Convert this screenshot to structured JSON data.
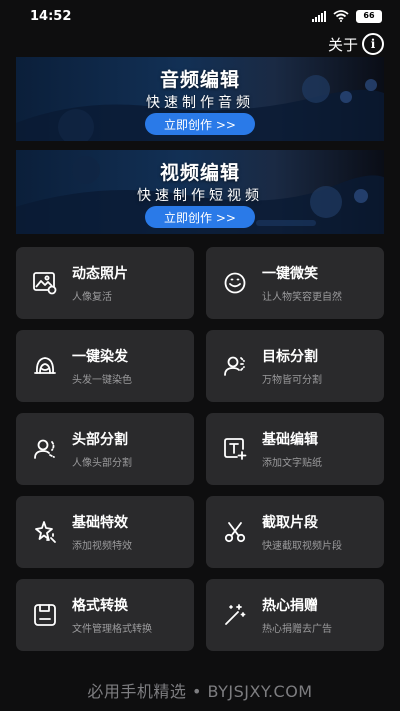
{
  "status_bar": {
    "time": "14:52",
    "battery": "66"
  },
  "header": {
    "about_label": "关于",
    "info_icon": "info-circle-icon"
  },
  "banners": [
    {
      "title": "音频编辑",
      "subtitle": "快速制作音频",
      "button": "立即创作 >>"
    },
    {
      "title": "视频编辑",
      "subtitle": "快速制作短视频",
      "button": "立即创作 >>"
    }
  ],
  "cards": [
    {
      "title": "动态照片",
      "subtitle": "人像复活",
      "icon": "photo-icon"
    },
    {
      "title": "一键微笑",
      "subtitle": "让人物笑容更自然",
      "icon": "smile-icon"
    },
    {
      "title": "一键染发",
      "subtitle": "头发一键染色",
      "icon": "hair-icon"
    },
    {
      "title": "目标分割",
      "subtitle": "万物皆可分割",
      "icon": "segment-icon"
    },
    {
      "title": "头部分割",
      "subtitle": "人像头部分割",
      "icon": "head-segment-icon"
    },
    {
      "title": "基础编辑",
      "subtitle": "添加文字贴纸",
      "icon": "text-add-icon"
    },
    {
      "title": "基础特效",
      "subtitle": "添加视频特效",
      "icon": "sparkle-icon"
    },
    {
      "title": "截取片段",
      "subtitle": "快速截取视频片段",
      "icon": "scissors-icon"
    },
    {
      "title": "格式转换",
      "subtitle": "文件管理格式转换",
      "icon": "save-icon"
    },
    {
      "title": "热心捐赠",
      "subtitle": "热心捐赠去广告",
      "icon": "magic-wand-icon"
    }
  ],
  "footer": {
    "watermark": "必用手机精选 • BYJSJXY.COM"
  },
  "colors": {
    "background": "#0e0e0f",
    "card": "#2a2a2c",
    "accent": "#2a7ae8"
  }
}
